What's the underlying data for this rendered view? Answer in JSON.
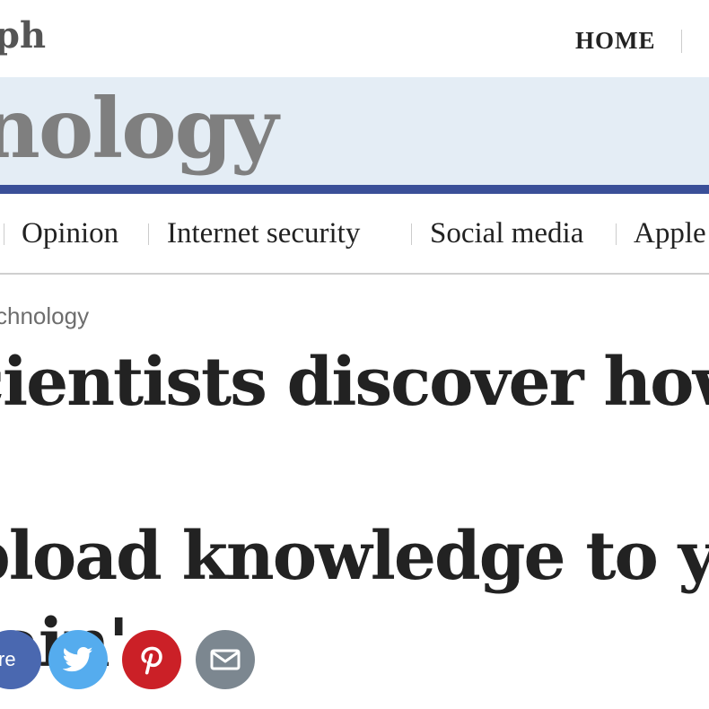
{
  "masthead": {
    "logo_fragment": "ph",
    "nav_home": "HOME"
  },
  "section": {
    "title": "nology"
  },
  "subnav": {
    "items": [
      {
        "label": "Opinion"
      },
      {
        "label": "Internet security"
      },
      {
        "label": "Social media"
      },
      {
        "label": "Apple"
      }
    ]
  },
  "article": {
    "breadcrumb": "chnology",
    "headline": "cientists discover how t\npload knowledge to yo\nrain'"
  },
  "share": {
    "facebook_label": "re",
    "icons": {
      "twitter": "twitter-bird-icon",
      "pinterest": "pinterest-p-icon",
      "email": "envelope-icon"
    }
  },
  "colors": {
    "banner_bg": "#e4edf5",
    "banner_rule": "#3a4f98",
    "facebook": "#4a68b0",
    "twitter": "#55acee",
    "pinterest": "#cb2027",
    "email": "#7c8790"
  }
}
